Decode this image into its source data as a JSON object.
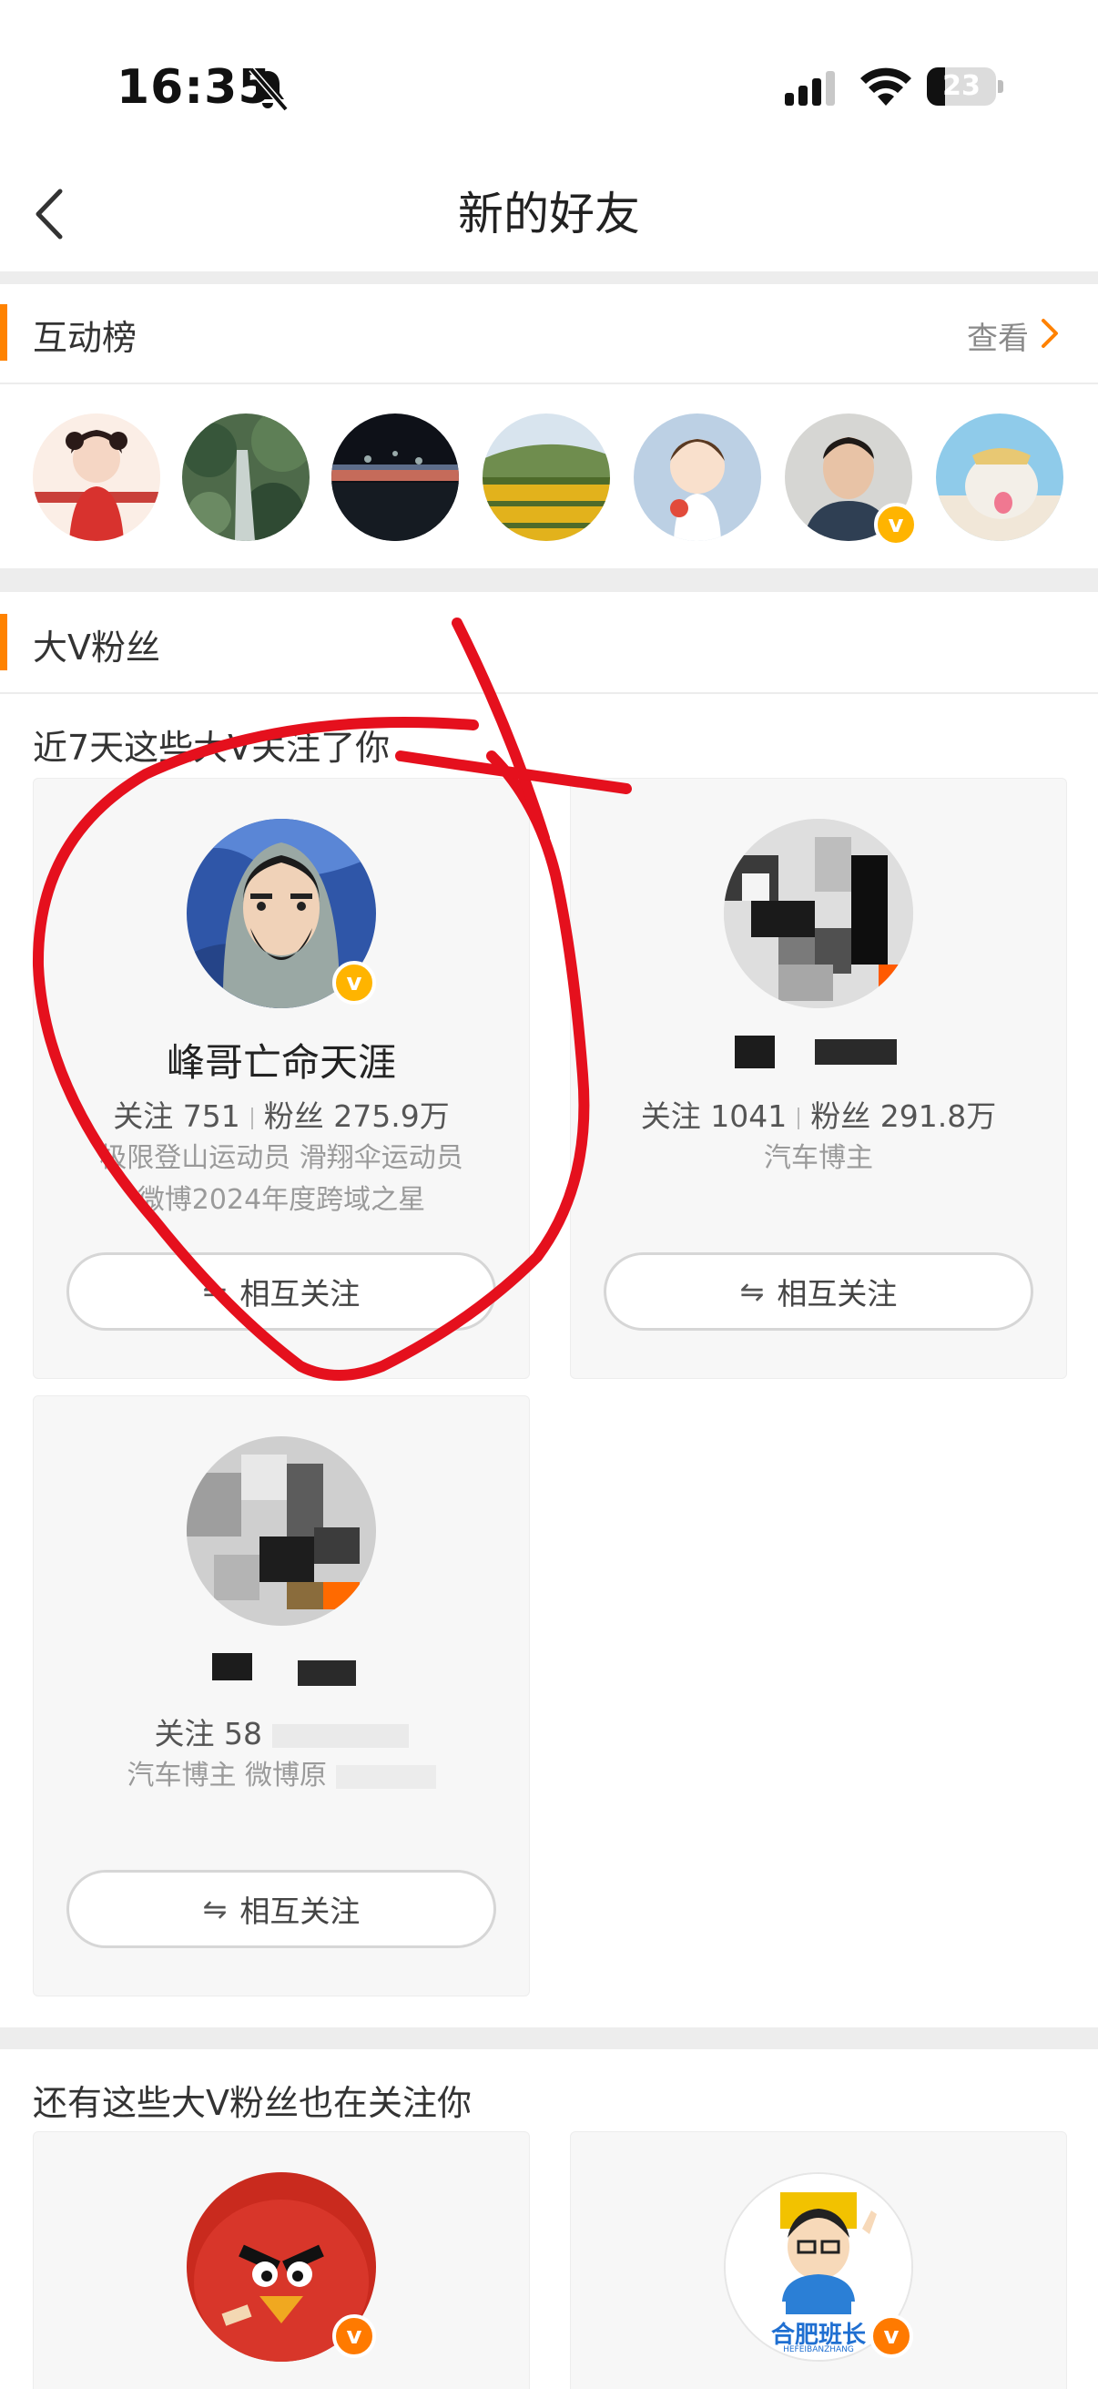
{
  "status_bar": {
    "time": "16:35",
    "battery": "23"
  },
  "nav": {
    "title": "新的好友"
  },
  "interaction_rank": {
    "title": "互动榜",
    "view_label": "查看"
  },
  "bigv_section": {
    "title": "大V粉丝",
    "subtitle": "近7天这些大V关注了你",
    "cards": [
      {
        "name": "峰哥亡命天涯",
        "follow_label": "关注",
        "follow_count": "751",
        "fans_label": "粉丝",
        "fans_count": "275.9万",
        "desc_line1": "极限登山运动员 滑翔伞运动员",
        "desc_line2": "微博2024年度跨域之星",
        "button": "相互关注"
      },
      {
        "name": "",
        "follow_label": "关注",
        "follow_count": "1041",
        "fans_label": "粉丝",
        "fans_count": "291.8万",
        "desc_line1": "汽车博主",
        "desc_line2": "",
        "button": "相互关注"
      },
      {
        "name": "",
        "follow_label": "关注",
        "follow_count": "58",
        "fans_label": "",
        "fans_count": "",
        "desc_line1": "汽车博主 微博原",
        "desc_line2": "",
        "button": "相互关注"
      }
    ]
  },
  "more_section": {
    "title": "还有这些大V粉丝也在关注你",
    "logo_text": "合肥班长",
    "logo_sub": "HEFEIBANZHANG"
  },
  "icons": {
    "back": "chevron-left-icon",
    "view_more": "chevron-right-icon",
    "mute": "bell-slash-icon",
    "mutual": "swap-arrows-icon",
    "verified": "verified-v-icon"
  },
  "colors": {
    "accent": "#ff8200",
    "verified_gold": "#ffb400",
    "verified_orange": "#ff7a00",
    "annotation_red": "#e5101d"
  }
}
